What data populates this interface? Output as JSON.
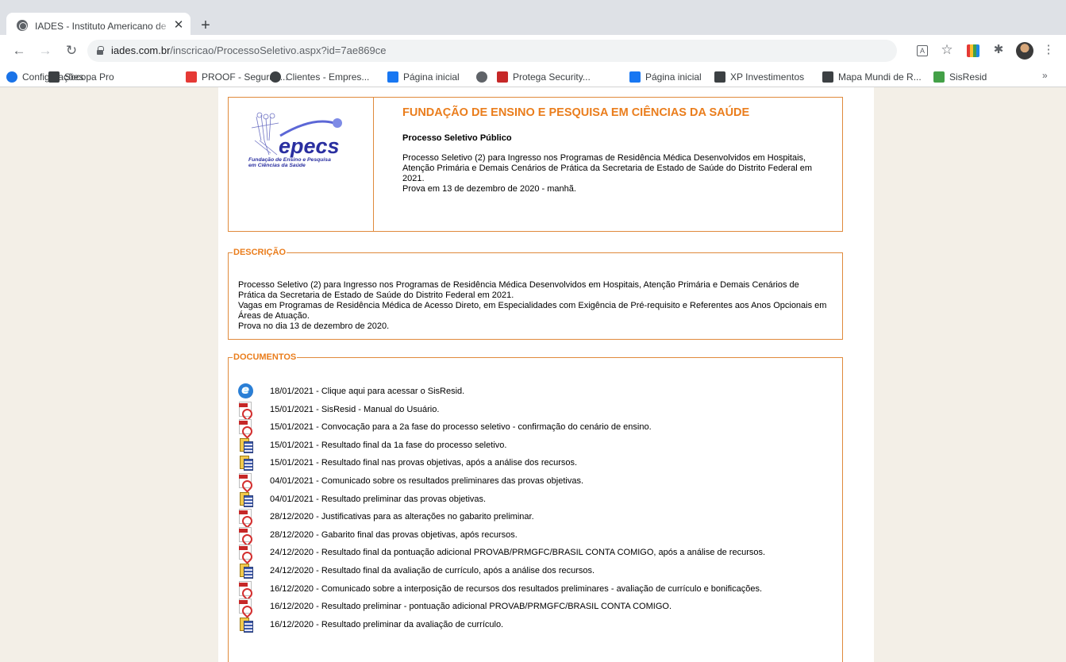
{
  "browser": {
    "tab_title": "IADES - Instituto Americano de",
    "url_host": "iades.com.br",
    "url_path": "/inscricao/ProcessoSeletivo.aspx?id=7ae869ce",
    "bookmarks": [
      {
        "label": "Configurações",
        "icon": "gear-icon",
        "color": "#1a73e8"
      },
      {
        "label": "Socopa Pro",
        "icon": "socopa-icon",
        "color": "#3c4043"
      },
      {
        "label": "PROOF - Seguran...",
        "icon": "proof-icon",
        "color": "#e53935"
      },
      {
        "label": "Clientes - Empres...",
        "icon": "half-moon-icon",
        "color": "#3c4043"
      },
      {
        "label": "Página inicial",
        "icon": "facebook-icon",
        "color": "#1877f2"
      },
      {
        "label": "",
        "icon": "globe-icon",
        "color": "#5f6368"
      },
      {
        "label": "Protega Security...",
        "icon": "shield-icon",
        "color": "#c62828"
      },
      {
        "label": "Página inicial",
        "icon": "facebook-icon",
        "color": "#1877f2"
      },
      {
        "label": "XP Investimentos",
        "icon": "xp-icon",
        "color": "#3c4043"
      },
      {
        "label": "Mapa Mundi de R...",
        "icon": "mapa-icon",
        "color": "#3c4043"
      },
      {
        "label": "SisResid",
        "icon": "sisresid-icon",
        "color": "#43a047"
      }
    ],
    "bookmarks_more": "»"
  },
  "header": {
    "org_title": "FUNDAÇÃO DE ENSINO E PESQUISA EM CIÊNCIAS DA SAÚDE",
    "process_title": "Processo Seletivo Público",
    "process_desc_lines": [
      "Processo Seletivo (2) para Ingresso nos Programas de Residência Médica Desenvolvidos em Hospitais,",
      "Atenção Primária e Demais Cenários de Prática da Secretaria de Estado de Saúde do Distrito Federal em",
      "2021.",
      "Prova em 13 de dezembro de 2020 - manhã."
    ],
    "logo": {
      "name": "epecs",
      "subtitle_lines": [
        "Fundação de Ensino e Pesquisa",
        "em Ciências da Saúde"
      ]
    }
  },
  "descricao": {
    "legend": "DESCRIÇÃO",
    "lines": [
      "Processo Seletivo (2) para Ingresso nos Programas de Residência Médica Desenvolvidos em Hospitais, Atenção Primária e Demais Cenários de",
      "Prática da Secretaria de Estado de Saúde do Distrito Federal em 2021.",
      "Vagas em Programas de Residência Médica de Acesso Direto, em Especialidades com Exigência de Pré-requisito e Referentes aos Anos Opcionais em",
      "Áreas de Atuação.",
      "Prova no dia 13 de dezembro de 2020."
    ]
  },
  "documentos": {
    "legend": "DOCUMENTOS",
    "items": [
      {
        "icon": "ie-link-icon",
        "text": "18/01/2021 - Clique aqui para acessar o SisResid."
      },
      {
        "icon": "pdf-icon",
        "text": "15/01/2021 - SisResid - Manual do Usuário."
      },
      {
        "icon": "pdf-icon",
        "text": "15/01/2021 - Convocação para a 2a fase do processo seletivo - confirmação do cenário de ensino."
      },
      {
        "icon": "spreadsheet-icon",
        "text": "15/01/2021 - Resultado final da 1a fase do processo seletivo."
      },
      {
        "icon": "spreadsheet-icon",
        "text": "15/01/2021 - Resultado final nas provas objetivas, após a análise dos recursos."
      },
      {
        "icon": "pdf-icon",
        "text": "04/01/2021 - Comunicado sobre os resultados preliminares das provas objetivas."
      },
      {
        "icon": "spreadsheet-icon",
        "text": "04/01/2021 - Resultado preliminar das provas objetivas."
      },
      {
        "icon": "pdf-icon",
        "text": "28/12/2020 - Justificativas para as alterações no gabarito preliminar."
      },
      {
        "icon": "pdf-icon",
        "text": "28/12/2020 - Gabarito final das provas objetivas, após recursos."
      },
      {
        "icon": "pdf-icon",
        "text": "24/12/2020 - Resultado final da pontuação adicional PROVAB/PRMGFC/BRASIL CONTA COMIGO, após a análise de recursos."
      },
      {
        "icon": "spreadsheet-icon",
        "text": "24/12/2020 - Resultado final da avaliação de currículo, após a análise dos recursos."
      },
      {
        "icon": "pdf-icon",
        "text": "16/12/2020 - Comunicado sobre a interposição de recursos dos resultados preliminares - avaliação de currículo e bonificações."
      },
      {
        "icon": "pdf-icon",
        "text": "16/12/2020 - Resultado preliminar - pontuação adicional PROVAB/PRMGFC/BRASIL CONTA COMIGO."
      },
      {
        "icon": "spreadsheet-icon",
        "text": "16/12/2020 - Resultado preliminar da avaliação de currículo."
      }
    ]
  },
  "colors": {
    "accent": "#ea7d1c",
    "border": "#e08a3c",
    "page_bg": "#f3efe7"
  }
}
